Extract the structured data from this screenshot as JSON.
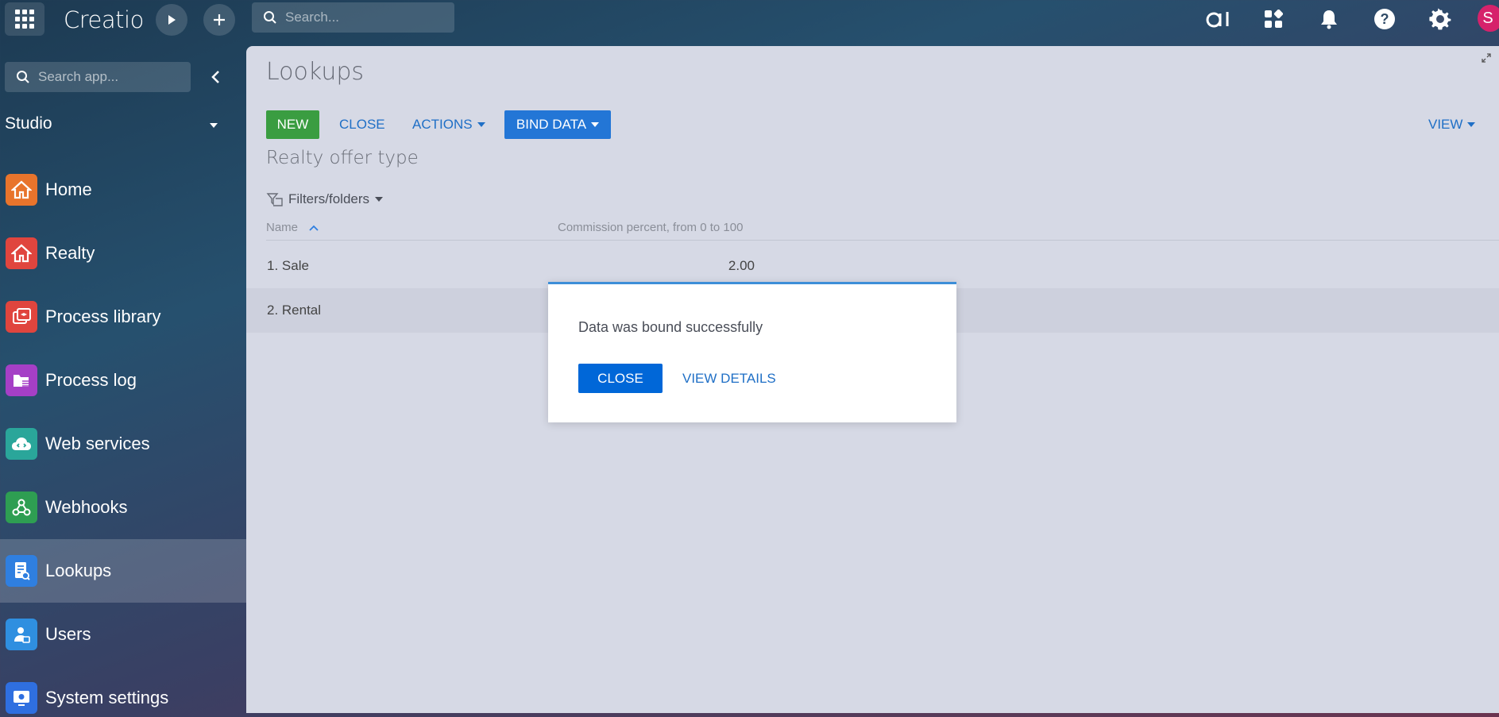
{
  "topbar": {
    "app_name": "Creatio",
    "search_placeholder": "Search...",
    "user_initial": "S"
  },
  "sidebar": {
    "search_placeholder": "Search app...",
    "workspace": "Studio",
    "items": [
      {
        "label": "Home",
        "icon": "home-icon",
        "color": "#e8742c"
      },
      {
        "label": "Realty",
        "icon": "home-icon",
        "color": "#e0453e"
      },
      {
        "label": "Process library",
        "icon": "process-library-icon",
        "color": "#e0453e"
      },
      {
        "label": "Process log",
        "icon": "process-log-icon",
        "color": "#a53fc6"
      },
      {
        "label": "Web services",
        "icon": "cloud-icon",
        "color": "#2aa69a"
      },
      {
        "label": "Webhooks",
        "icon": "webhook-icon",
        "color": "#2e9e52"
      },
      {
        "label": "Lookups",
        "icon": "lookup-icon",
        "color": "#2f7fe0",
        "active": true
      },
      {
        "label": "Users",
        "icon": "users-icon",
        "color": "#2f8fe0"
      },
      {
        "label": "System settings",
        "icon": "settings-icon",
        "color": "#2f6fe0"
      }
    ]
  },
  "main": {
    "title": "Lookups",
    "toolbar": {
      "new_label": "NEW",
      "close_label": "CLOSE",
      "actions_label": "ACTIONS",
      "bind_label": "BIND DATA",
      "view_label": "VIEW"
    },
    "subtitle": "Realty offer type",
    "filters_label": "Filters/folders",
    "columns": {
      "name": "Name",
      "commission": "Commission percent, from 0 to 100"
    },
    "rows": [
      {
        "name": "1. Sale",
        "commission": "2.00"
      },
      {
        "name": "2. Rental",
        "commission": ""
      }
    ]
  },
  "dialog": {
    "message": "Data was bound successfully",
    "close_label": "CLOSE",
    "details_label": "VIEW DETAILS"
  }
}
